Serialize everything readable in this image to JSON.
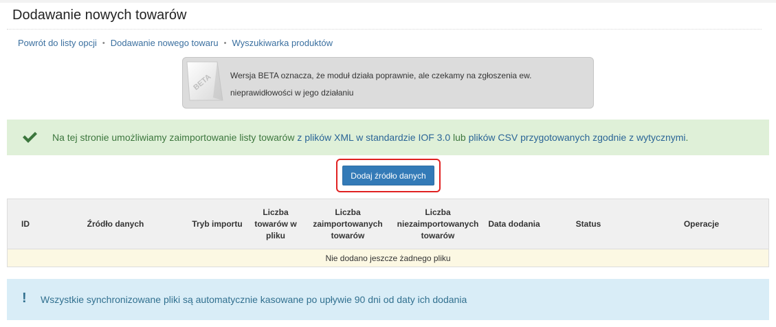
{
  "page": {
    "title": "Dodawanie nowych towarów"
  },
  "breadcrumb": {
    "items": [
      {
        "label": "Powrót do listy opcji"
      },
      {
        "label": "Dodawanie nowego towaru"
      },
      {
        "label": "Wyszukiwarka produktów"
      }
    ],
    "separator": "•"
  },
  "beta_notice": {
    "badge": "BETA",
    "text": "Wersja BETA oznacza, że moduł działa poprawnie, ale czekamy na zgłoszenia ew. nieprawidłowości w jego działaniu"
  },
  "success_alert": {
    "icon": "check-icon",
    "text_before": "Na tej stronie umożliwiamy zaimportowanie listy towarów ",
    "link1": "z plików XML w standardzie IOF 3.0",
    "text_middle": " lub ",
    "link2": "plików CSV przygotowanych zgodnie z wytycznymi",
    "text_after": "."
  },
  "add_button": {
    "label": "Dodaj źródło danych"
  },
  "table": {
    "columns": {
      "id": "ID",
      "source": "Źródło danych",
      "mode": "Tryb importu",
      "count_file": "Liczba towarów w pliku",
      "count_imported": "Liczba zaimportowanych towarów",
      "count_not_imported": "Liczba niezaimportowanych towarów",
      "date": "Data dodania",
      "status": "Status",
      "ops": "Operacje"
    },
    "empty_message": "Nie dodano jeszcze żadnego pliku"
  },
  "info_alert": {
    "icon": "exclamation-icon",
    "text": "Wszystkie synchronizowane pliki są automatycznie kasowane po upływie 90 dni od daty ich dodania"
  },
  "colors": {
    "primary": "#337ab7",
    "success_bg": "#dff0d8",
    "info_bg": "#d9edf7",
    "warning_bg": "#fcf8e3",
    "highlight": "#e02020"
  }
}
